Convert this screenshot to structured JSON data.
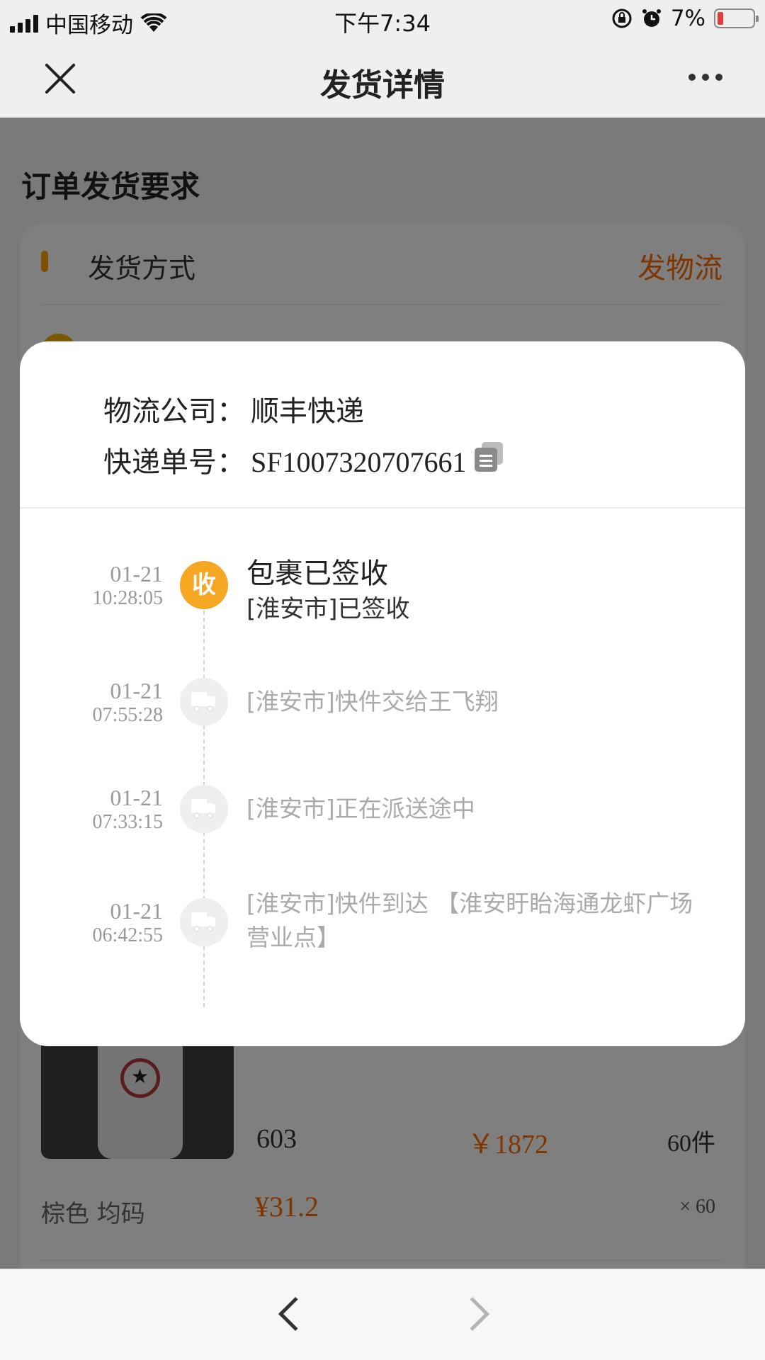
{
  "status_bar": {
    "carrier": "中国移动",
    "time": "下午7:34",
    "battery": "7%",
    "battery_level": 0.07
  },
  "nav": {
    "title": "发货详情"
  },
  "background": {
    "section_title": "订单发货要求",
    "ship_method_label": "发货方式",
    "ship_method_value": "发物流",
    "product_code": "603",
    "product_total": "￥1872",
    "product_count": "60件",
    "variant": "棕色 均码",
    "unit_price": "¥31.2",
    "quantity": "× 60"
  },
  "logistics": {
    "company_label": "物流公司：",
    "company_value": "顺丰快递",
    "tracking_label": "快递单号：",
    "tracking_value": "SF1007320707661",
    "events": [
      {
        "date": "01-21",
        "time": "10:28:05",
        "title": "包裹已签收",
        "desc": "[淮安市]已签收",
        "badge": "收",
        "icon": "received-badge"
      },
      {
        "date": "01-21",
        "time": "07:55:28",
        "desc": "[淮安市]快件交给王飞翔",
        "icon": "truck-icon"
      },
      {
        "date": "01-21",
        "time": "07:33:15",
        "desc": "[淮安市]正在派送途中",
        "icon": "truck-icon"
      },
      {
        "date": "01-21",
        "time": "06:42:55",
        "desc": "[淮安市]快件到达 【淮安盱眙海通龙虾广场营业点】",
        "icon": "truck-icon"
      }
    ]
  },
  "colors": {
    "accent": "#ff6a00",
    "badge": "#f5a623"
  }
}
